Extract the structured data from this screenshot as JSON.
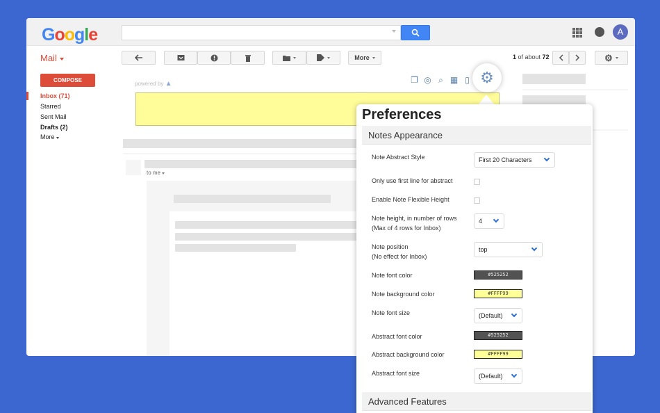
{
  "app": {
    "logo": [
      "G",
      "o",
      "o",
      "g",
      "l",
      "e"
    ],
    "logo_colors": [
      "#4285f4",
      "#ea4335",
      "#fbbc05",
      "#4285f4",
      "#34a853",
      "#ea4335"
    ],
    "avatar_letter": "A"
  },
  "toolbar": {
    "mail_label": "Mail",
    "more_label": "More",
    "page_start": "1",
    "page_mid": " of about ",
    "page_total": "72"
  },
  "sidebar": {
    "compose_label": "COMPOSE",
    "items": [
      {
        "label": "Inbox (71)"
      },
      {
        "label": "Starred"
      },
      {
        "label": "Sent Mail"
      },
      {
        "label": "Drafts (2)"
      },
      {
        "label": "More"
      }
    ]
  },
  "mail": {
    "powered_by": "powered by",
    "to_me": "to me"
  },
  "preferences": {
    "title": "Preferences",
    "section_notes": "Notes Appearance",
    "section_advanced": "Advanced Features",
    "rows": {
      "abstract_style": {
        "label": "Note Abstract Style",
        "value": "First 20 Characters"
      },
      "first_line": {
        "label": "Only use first line for abstract"
      },
      "flexible_height": {
        "label": "Enable Note Flexible Height"
      },
      "note_height": {
        "label_1": "Note height, in number of rows",
        "label_2": "(Max of 4 rows for Inbox)",
        "value": "4"
      },
      "note_position": {
        "label_1": "Note position",
        "label_2": "(No effect for Inbox)",
        "value": "top"
      },
      "font_color": {
        "label": "Note font color",
        "value": "#525252"
      },
      "bg_color": {
        "label": "Note background color",
        "value": "#FFFF99"
      },
      "font_size": {
        "label": "Note font size",
        "value": "(Default)"
      },
      "abstract_font_color": {
        "label": "Abstract font color",
        "value": "#525252"
      },
      "abstract_bg_color": {
        "label": "Abstract background color",
        "value": "#FFFF99"
      },
      "abstract_font_size": {
        "label": "Abstract font size",
        "value": "(Default)"
      }
    }
  },
  "colors": {
    "background": "#3d67d0",
    "accent_red": "#dd4b39",
    "accent_blue": "#4285f4",
    "note_yellow": "#fffd9a",
    "swatch_dark": "#525252",
    "swatch_yellow": "#ffff99"
  },
  "icons": [
    "search-icon",
    "apps-icon",
    "notifications-icon",
    "reply-icon",
    "archive-icon",
    "report-spam-icon",
    "delete-icon",
    "folder-icon",
    "label-icon",
    "chevron-left-icon",
    "chevron-right-icon",
    "settings-icon",
    "gear-icon",
    "chevron-down-icon"
  ]
}
